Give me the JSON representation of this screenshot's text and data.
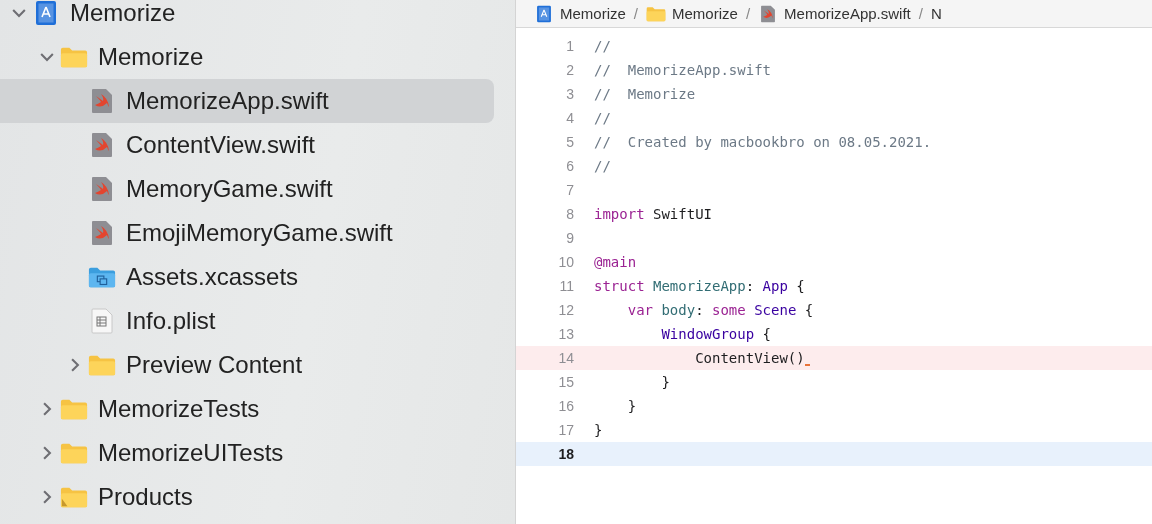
{
  "navigator": {
    "items": [
      {
        "label": "Memorize",
        "kind": "project",
        "expanded": true,
        "selected": false,
        "children": [
          {
            "label": "Memorize",
            "kind": "folder",
            "expanded": true,
            "selected": false,
            "children": [
              {
                "label": "MemorizeApp.swift",
                "kind": "swift",
                "selected": true
              },
              {
                "label": "ContentView.swift",
                "kind": "swift",
                "selected": false
              },
              {
                "label": "MemoryGame.swift",
                "kind": "swift",
                "selected": false
              },
              {
                "label": "EmojiMemoryGame.swift",
                "kind": "swift",
                "selected": false
              },
              {
                "label": "Assets.xcassets",
                "kind": "assets",
                "selected": false
              },
              {
                "label": "Info.plist",
                "kind": "plist",
                "selected": false
              },
              {
                "label": "Preview Content",
                "kind": "folder",
                "expanded": false,
                "selected": false
              }
            ]
          },
          {
            "label": "MemorizeTests",
            "kind": "folder",
            "expanded": false,
            "selected": false
          },
          {
            "label": "MemorizeUITests",
            "kind": "folder",
            "expanded": false,
            "selected": false
          },
          {
            "label": "Products",
            "kind": "products",
            "expanded": false,
            "selected": false
          }
        ]
      }
    ]
  },
  "breadcrumb": [
    {
      "label": "Memorize",
      "kind": "project"
    },
    {
      "label": "/",
      "kind": "separator"
    },
    {
      "label": "Memorize",
      "kind": "folder"
    },
    {
      "label": "/",
      "kind": "separator"
    },
    {
      "label": "MemorizeApp.swift",
      "kind": "swift"
    },
    {
      "label": "/",
      "kind": "separator"
    },
    {
      "label": "N",
      "kind": "text"
    }
  ],
  "editor": {
    "lines": [
      {
        "number": "1",
        "tokens": [
          {
            "text": "//",
            "kind": "comment"
          }
        ]
      },
      {
        "number": "2",
        "tokens": [
          {
            "text": "//  MemorizeApp.swift",
            "kind": "comment"
          }
        ]
      },
      {
        "number": "3",
        "tokens": [
          {
            "text": "//  Memorize",
            "kind": "comment"
          }
        ]
      },
      {
        "number": "4",
        "tokens": [
          {
            "text": "//",
            "kind": "comment"
          }
        ]
      },
      {
        "number": "5",
        "tokens": [
          {
            "text": "//  Created by macbookbro on 08.05.2021.",
            "kind": "comment"
          }
        ]
      },
      {
        "number": "6",
        "tokens": [
          {
            "text": "//",
            "kind": "comment"
          }
        ]
      },
      {
        "number": "7"
      },
      {
        "number": "8",
        "tokens": [
          {
            "text": "import ",
            "kind": "keyword"
          },
          {
            "text": "SwiftUI",
            "kind": "plain"
          }
        ]
      },
      {
        "number": "9"
      },
      {
        "number": "10",
        "tokens": [
          {
            "text": "@main",
            "kind": "keyword"
          }
        ]
      },
      {
        "number": "11",
        "tokens": [
          {
            "text": "struct ",
            "kind": "keyword"
          },
          {
            "text": "MemorizeApp",
            "kind": "declaration"
          },
          {
            "text": ": ",
            "kind": "plain"
          },
          {
            "text": "App",
            "kind": "type"
          },
          {
            "text": " {",
            "kind": "plain"
          }
        ]
      },
      {
        "number": "12",
        "tokens": [
          {
            "text": "    var ",
            "kind": "keyword"
          },
          {
            "text": "body",
            "kind": "declaration"
          },
          {
            "text": ": ",
            "kind": "plain"
          },
          {
            "text": "some ",
            "kind": "keyword"
          },
          {
            "text": "Scene",
            "kind": "type"
          },
          {
            "text": " {",
            "kind": "plain"
          }
        ]
      },
      {
        "number": "13",
        "tokens": [
          {
            "text": "        WindowGroup",
            "kind": "type"
          },
          {
            "text": " {",
            "kind": "plain"
          }
        ]
      },
      {
        "number": "14",
        "issue": true,
        "tokens": [
          {
            "text": "            ContentView()",
            "kind": "plain"
          }
        ]
      },
      {
        "number": "15",
        "tokens": [
          {
            "text": "        }",
            "kind": "plain"
          }
        ]
      },
      {
        "number": "16",
        "tokens": [
          {
            "text": "    }",
            "kind": "plain"
          }
        ]
      },
      {
        "number": "17",
        "tokens": [
          {
            "text": "}",
            "kind": "plain"
          }
        ]
      },
      {
        "number": "18",
        "current": true
      }
    ]
  }
}
